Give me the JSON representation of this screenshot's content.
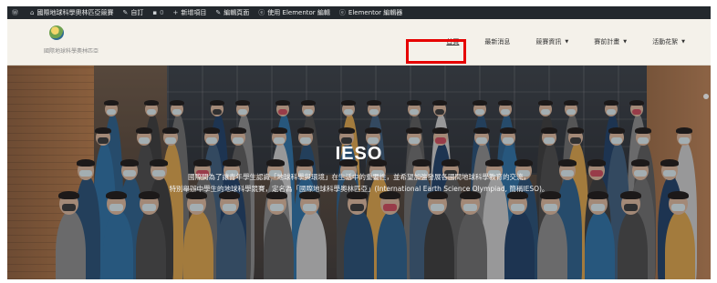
{
  "admin_bar": {
    "wp_icon": "wordpress-icon",
    "site_name": "國際地球科學奧林匹亞競賽",
    "customize": "自訂",
    "comments_count": "0",
    "new_item": "新增項目",
    "edit_page": "編輯頁面",
    "edit_elementor": "使用 Elementor 編輯",
    "elementor_editor": "Elementor 編輯器"
  },
  "header": {
    "logo_text": "國際地球科學奧林匹亞",
    "nav": [
      {
        "label": "首頁"
      },
      {
        "label": "最新消息"
      },
      {
        "label": "競賽資訊"
      },
      {
        "label": "賽前計畫"
      },
      {
        "label": "活動花絮"
      }
    ]
  },
  "hero": {
    "title": "IESO",
    "desc_line1": "國際間為了讓青年學生認識「地球科學與環境」在生活中的重要性，並希望加強發展各國間地球科學教育的交流，",
    "desc_line2": "特別舉辦中學生的地球科學競賽，定名為「國際地球科學奧林匹亞」(International Earth Science Olympiad, 簡稱IESO)。"
  },
  "colors": {
    "admin_bar_bg": "#23282d",
    "header_bg": "#f4f1ea",
    "highlight_border": "#e60000"
  }
}
